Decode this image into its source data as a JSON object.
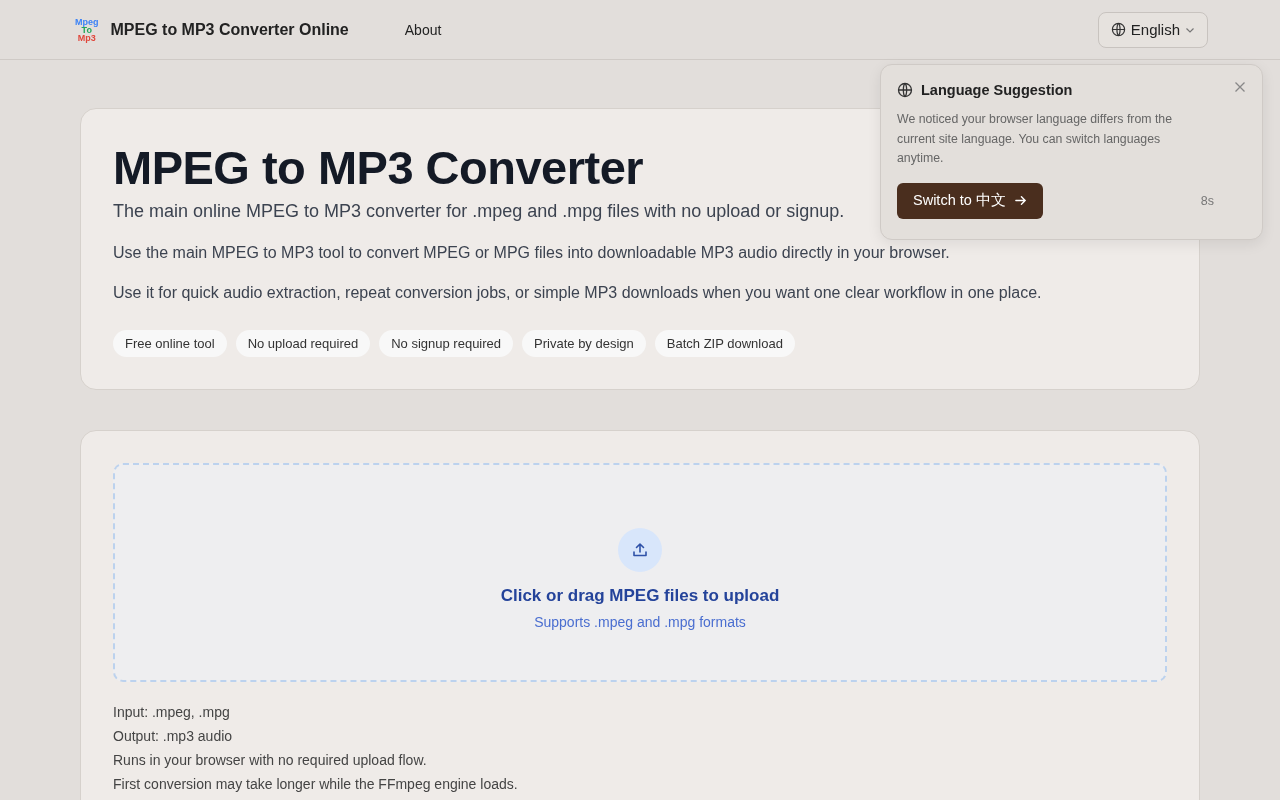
{
  "header": {
    "logo": [
      {
        "text": "Mpeg",
        "color": "#3b82f6"
      },
      {
        "text": "To",
        "color": "#22a55a"
      },
      {
        "text": "Mp3",
        "color": "#e0453a"
      }
    ],
    "site_name": "MPEG to MP3 Converter Online",
    "nav": [
      {
        "label": "About"
      }
    ],
    "language_button": {
      "label": "English"
    }
  },
  "hero": {
    "title": "MPEG to MP3 Converter",
    "subtitle": "The main online MPEG to MP3 converter for .mpeg and .mpg files with no upload or signup.",
    "paragraphs": [
      "Use the main MPEG to MP3 tool to convert MPEG or MPG files into downloadable MP3 audio directly in your browser.",
      "Use it for quick audio extraction, repeat conversion jobs, or simple MP3 downloads when you want one clear workflow in one place."
    ],
    "tags": [
      "Free online tool",
      "No upload required",
      "No signup required",
      "Private by design",
      "Batch ZIP download"
    ]
  },
  "upload": {
    "prompt": "Click or drag MPEG files to upload",
    "hint": "Supports .mpeg and .mpg formats",
    "notes": [
      "Input: .mpeg, .mpg",
      "Output: .mp3 audio",
      "Runs in your browser with no required upload flow.",
      "First conversion may take longer while the FFmpeg engine loads."
    ]
  },
  "language_popup": {
    "title": "Language Suggestion",
    "message": "We noticed your browser language differs from the current site language. You can switch languages anytime.",
    "button": "Switch to 中文",
    "countdown": "8s"
  }
}
